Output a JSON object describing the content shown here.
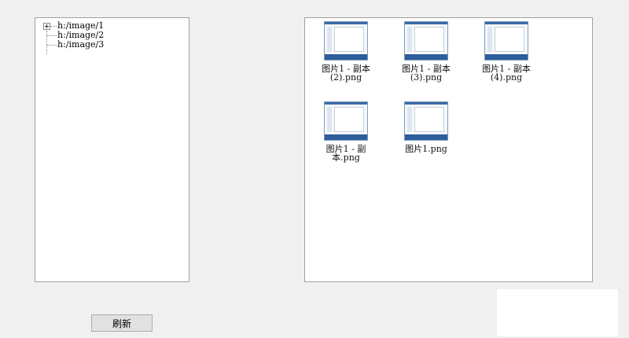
{
  "tree": {
    "items": [
      {
        "label": "h:/image/1",
        "expandable": true
      },
      {
        "label": "h:/image/2",
        "expandable": false
      },
      {
        "label": "h:/image/3",
        "expandable": false
      }
    ]
  },
  "files": {
    "items": [
      {
        "label": "图片1 - 副本 (2).png",
        "icon": "image-thumbnail"
      },
      {
        "label": "图片1 - 副本 (3).png",
        "icon": "image-thumbnail"
      },
      {
        "label": "图片1 - 副本 (4).png",
        "icon": "image-thumbnail"
      },
      {
        "label": "图片1 - 副本.png",
        "icon": "image-thumbnail"
      },
      {
        "label": "图片1.png",
        "icon": "image-thumbnail"
      }
    ]
  },
  "buttons": {
    "refresh_label": "刷新"
  }
}
